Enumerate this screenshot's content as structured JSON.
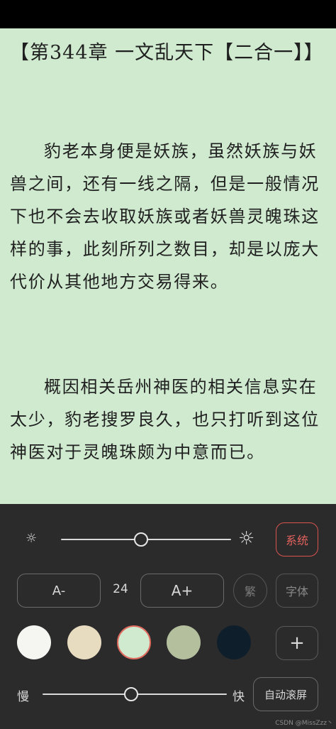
{
  "reader": {
    "chapter_title": "【第344章 一文乱天下【二合一】】",
    "paragraphs": [
      "豹老本身便是妖族，虽然妖族与妖兽之间，还有一线之隔，但是一般情况下也不会去收取妖族或者妖兽灵魄珠这样的事，此刻所列之数目，却是以庞大代价从其他地方交易得来。",
      "概因相关岳州神医的相关信息实在太少，豹老搜罗良久，也只打听到这位神医对于灵魄珠颇为中意而已。"
    ],
    "background_color": "#cfeacf"
  },
  "settings": {
    "brightness_low_icon": "sun-small-icon",
    "brightness_high_icon": "sun-large-icon",
    "brightness_level": 0.47,
    "system_label": "系统",
    "font_minus_label": "A-",
    "font_size": "24",
    "font_plus_label": "A+",
    "traditional_label": "繁",
    "font_label": "字体",
    "add_label": "+",
    "themes": [
      {
        "color": "#f5f5f2",
        "selected": false
      },
      {
        "color": "#e8dcc0",
        "selected": false
      },
      {
        "color": "#cfeacf",
        "selected": true
      },
      {
        "color": "#b4bf9e",
        "selected": false
      },
      {
        "color": "#0f1e2b",
        "selected": false
      }
    ],
    "speed_slow_label": "慢",
    "speed_fast_label": "快",
    "speed_level": 0.48,
    "autoscroll_label": "自动滚屏",
    "accent_color": "#e4625d"
  },
  "watermark": "CSDN @MissZzz丶"
}
